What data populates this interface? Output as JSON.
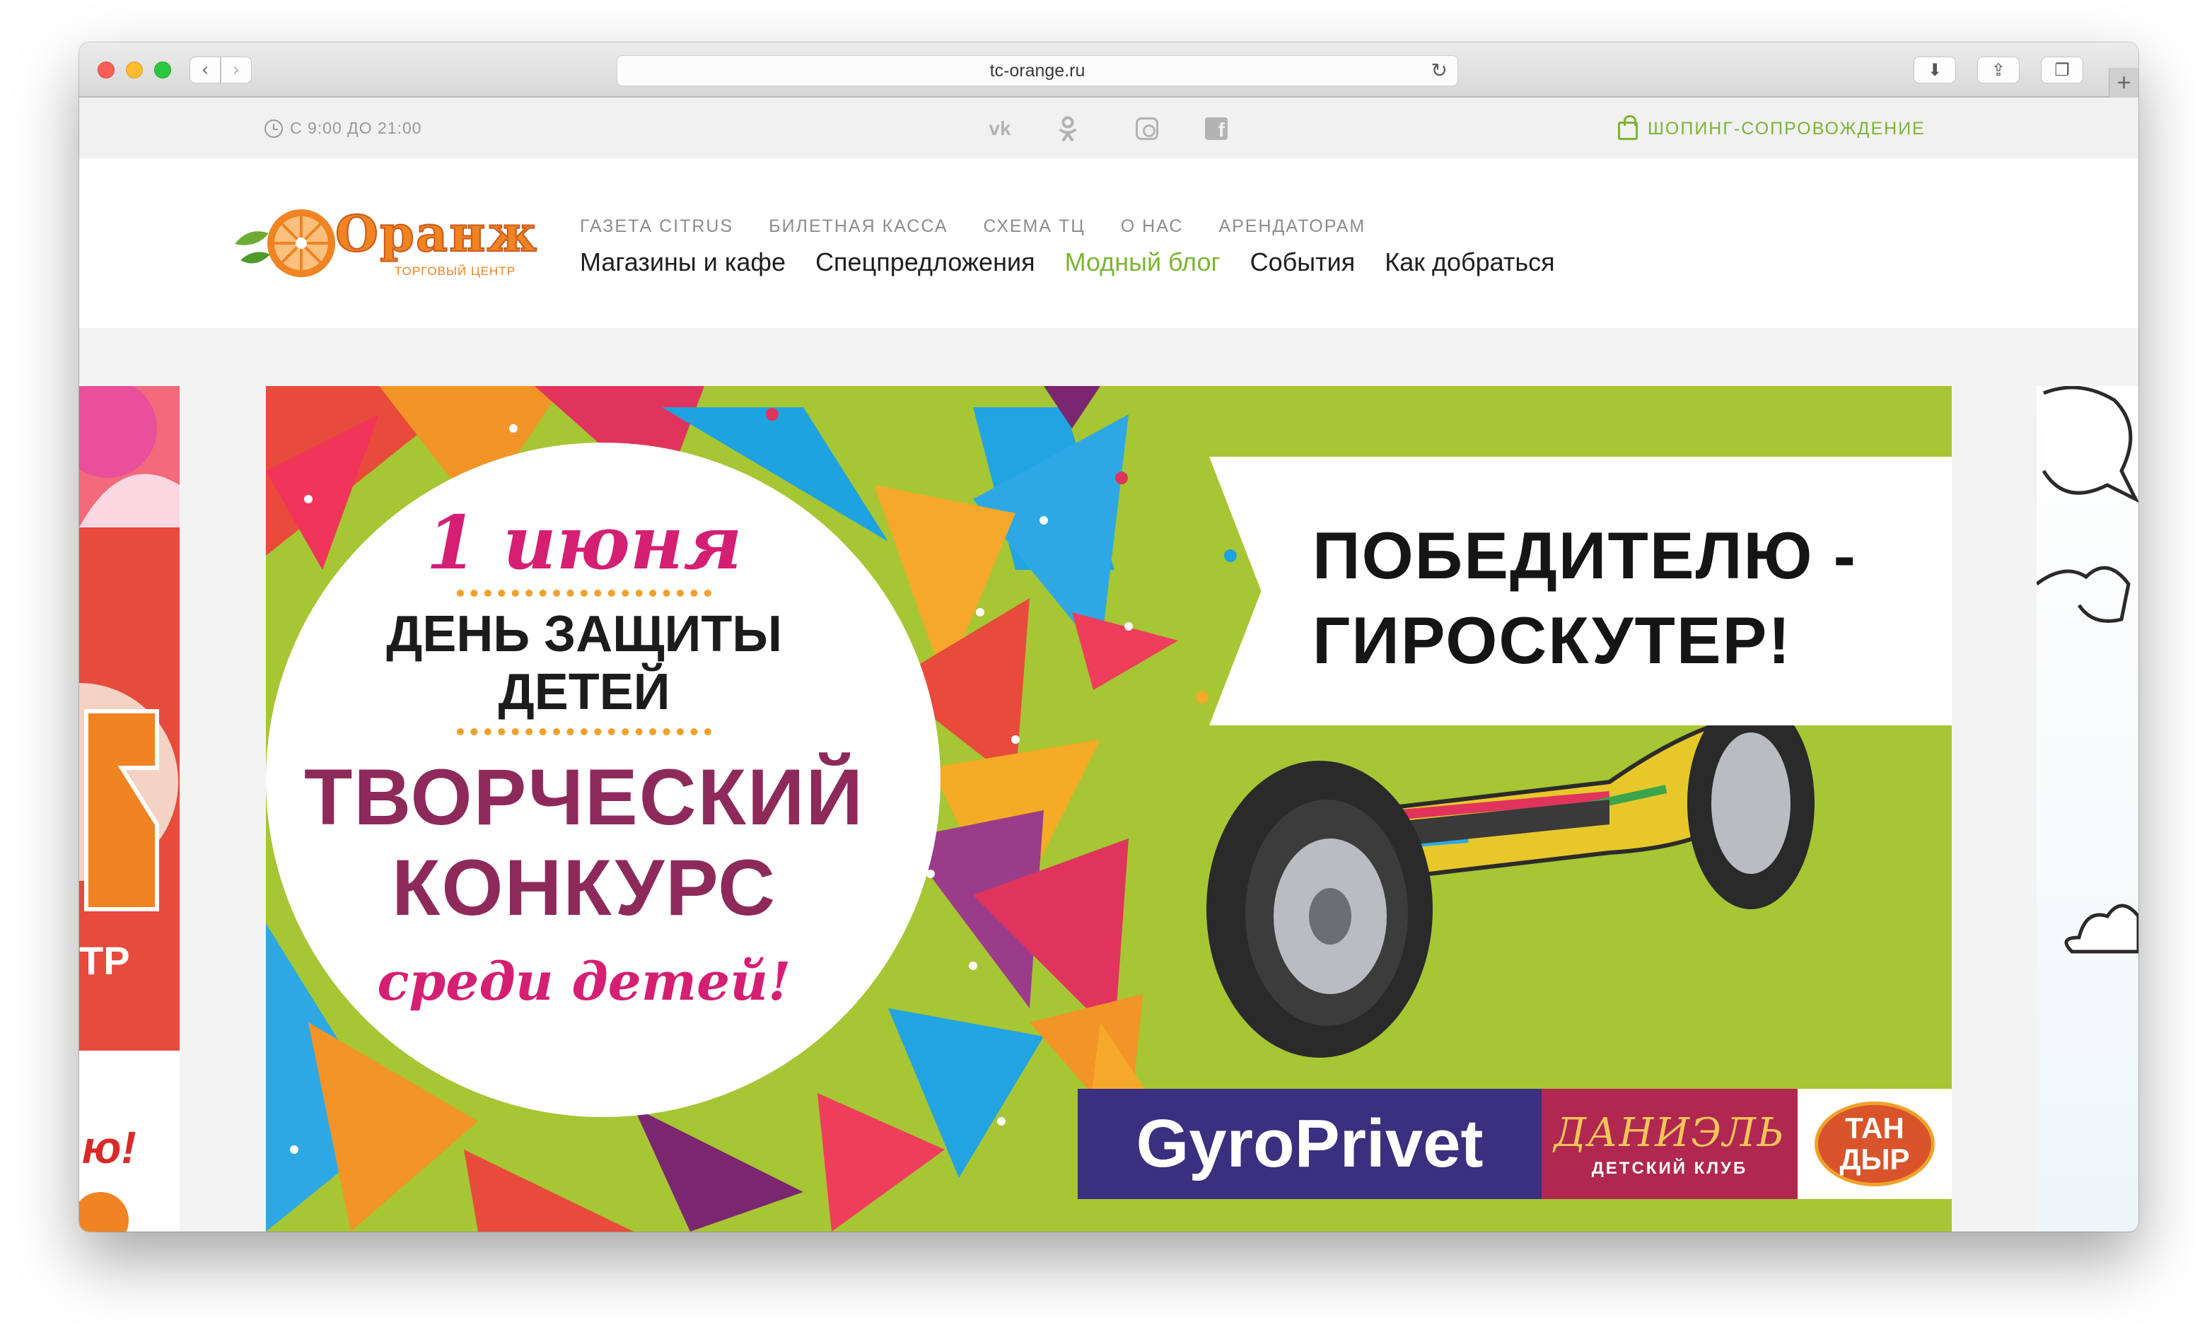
{
  "browser": {
    "url": "tc-orange.ru",
    "back_glyph": "‹",
    "forward_glyph": "›",
    "reload_glyph": "↻",
    "download_glyph": "⬇",
    "share_glyph": "⇪",
    "tabs_glyph": "❐",
    "new_tab_glyph": "+"
  },
  "topbar": {
    "hours": "С 9:00 ДО 21:00",
    "social": [
      "vk-icon",
      "ok-icon",
      "instagram-icon",
      "facebook-icon"
    ],
    "vk_label": "vk",
    "ok_label": "ok",
    "fb_label": "f",
    "shopping": "ШОПИНГ-СОПРОВОЖДЕНИЕ"
  },
  "header": {
    "logo_word": "Оранж",
    "logo_sub": "ТОРГОВЫЙ ЦЕНТР",
    "secondary_nav": [
      "ГАЗЕТА CITRUS",
      "БИЛЕТНАЯ КАССА",
      "СХЕМА ТЦ",
      "О НАС",
      "АРЕНДАТОРАМ"
    ],
    "main_nav": [
      "Магазины и кафе",
      "Спецпредложения",
      "Модный блог",
      "События",
      "Как добраться"
    ],
    "active_item": "Модный блог"
  },
  "banner": {
    "date": "1 июня",
    "day_line1": "ДЕНЬ ЗАЩИТЫ",
    "day_line2": "ДЕТЕЙ",
    "contest_line1": "ТВОРЧЕСКИЙ",
    "contest_line2": "КОНКУРС",
    "among": "среди детей!",
    "prize_line1": "ПОБЕДИТЕЛЮ -",
    "prize_line2": "ГИРОСКУТЕР!",
    "sponsor_gyro": "GyroPrivet",
    "sponsor_daniel": "ДАНИЭЛЬ",
    "sponsor_daniel_sub": "ДЕТСКИЙ КЛУБ",
    "sponsor_tandyr_1": "ТАН",
    "sponsor_tandyr_2": "ДЫР"
  },
  "peek_left": {
    "text1": "ТР",
    "text2": "ю!"
  },
  "colors": {
    "accent_green": "#7cb534",
    "brand_orange": "#f08322",
    "banner_green": "#a6c633"
  }
}
